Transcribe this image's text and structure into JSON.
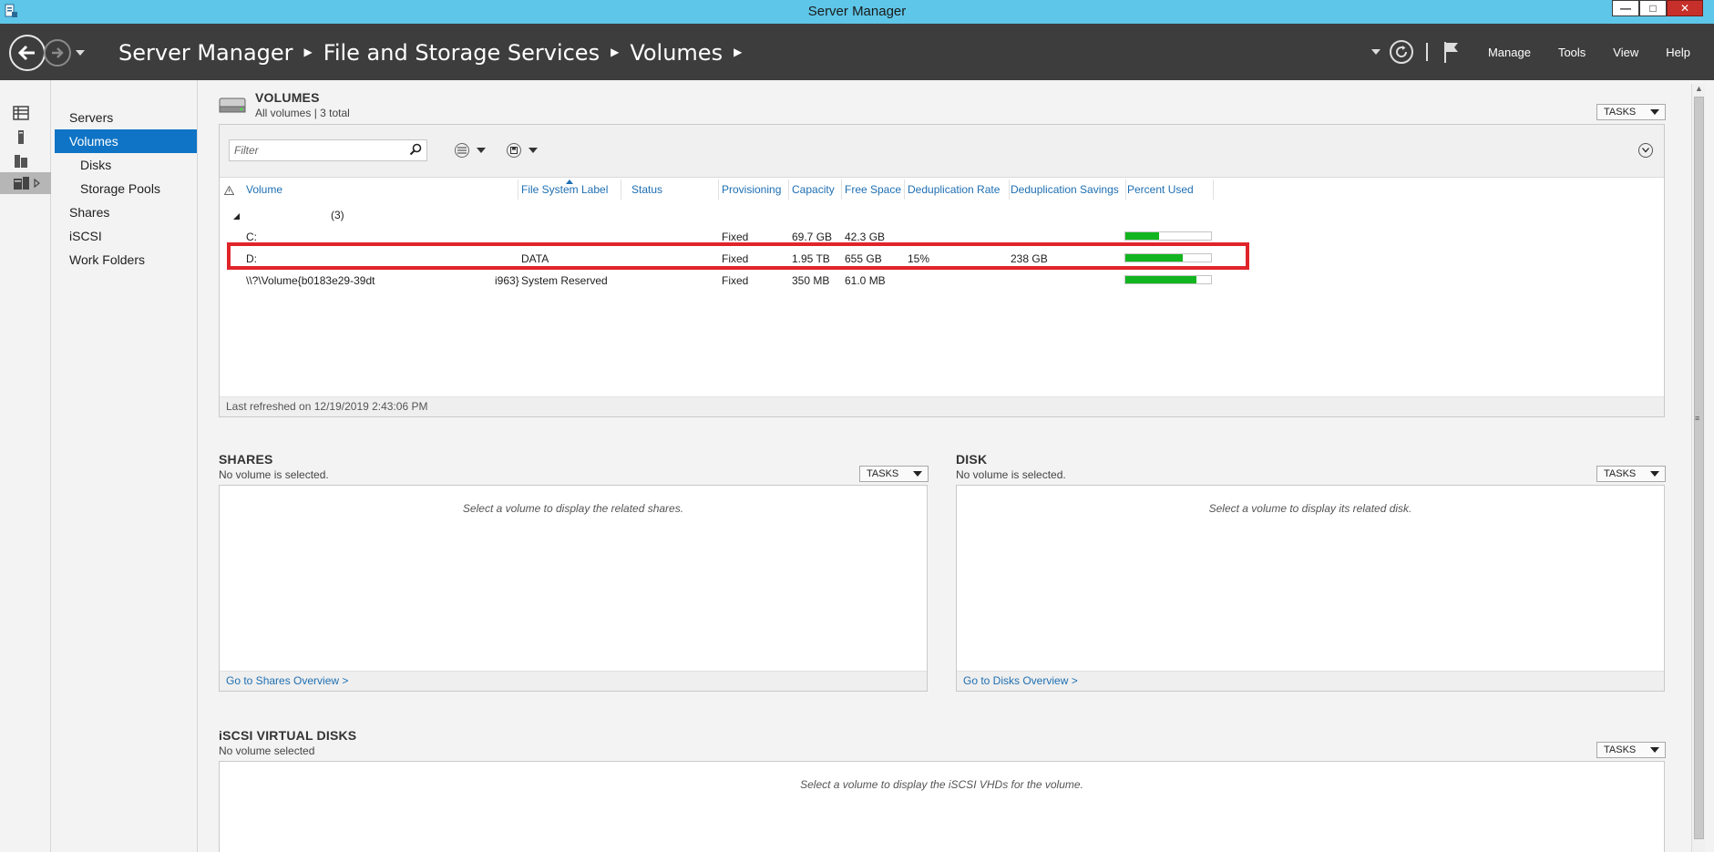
{
  "window": {
    "title": "Server Manager",
    "buttons": [
      "—",
      "□",
      "✕"
    ]
  },
  "header": {
    "breadcrumb": [
      "Server Manager",
      "File and Storage Services",
      "Volumes"
    ],
    "menu": [
      "Manage",
      "Tools",
      "View",
      "Help"
    ]
  },
  "sidebar": {
    "items": [
      "Servers",
      "Volumes",
      "Disks",
      "Storage Pools",
      "Shares",
      "iSCSI",
      "Work Folders"
    ]
  },
  "volumes": {
    "title": "VOLUMES",
    "subtitle": "All volumes | 3 total",
    "tasks": "TASKS",
    "filter_placeholder": "Filter",
    "columns": [
      "Volume",
      "File System Label",
      "Status",
      "Provisioning",
      "Capacity",
      "Free Space",
      "Deduplication Rate",
      "Deduplication Savings",
      "Percent Used"
    ],
    "group": "(3)",
    "rows": [
      {
        "volume": "C:",
        "label": "",
        "provisioning": "Fixed",
        "capacity": "69.7 GB",
        "free": "42.3 GB",
        "dedup_rate": "",
        "dedup_savings": "",
        "percent_used": 0.39
      },
      {
        "volume": "D:",
        "label": "DATA",
        "provisioning": "Fixed",
        "capacity": "1.95 TB",
        "free": "655 GB",
        "dedup_rate": "15%",
        "dedup_savings": "238 GB",
        "percent_used": 0.67
      },
      {
        "volume": "\\\\?\\Volume{b0183e29-39dt",
        "volume_tail": "i963}",
        "label": "System Reserved",
        "provisioning": "Fixed",
        "capacity": "350 MB",
        "free": "61.0 MB",
        "dedup_rate": "",
        "dedup_savings": "",
        "percent_used": 0.83
      }
    ],
    "status": "Last refreshed on 12/19/2019 2:43:06 PM"
  },
  "shares": {
    "title": "SHARES",
    "subtitle": "No volume is selected.",
    "tasks": "TASKS",
    "message": "Select a volume to display the related shares.",
    "link": "Go to Shares Overview >"
  },
  "disk": {
    "title": "DISK",
    "subtitle": "No volume is selected.",
    "tasks": "TASKS",
    "message": "Select a volume to display its related disk.",
    "link": "Go to Disks Overview >"
  },
  "iscsi": {
    "title": "iSCSI VIRTUAL DISKS",
    "subtitle": "No volume selected",
    "tasks": "TASKS",
    "message": "Select a volume to display the iSCSI VHDs for the volume."
  },
  "colors": {
    "titlebar": "#5ec6e8",
    "header": "#3d3d3d",
    "selection": "#0f74c6",
    "usage_bar": "#12b51f",
    "highlight": "#e0252a"
  }
}
